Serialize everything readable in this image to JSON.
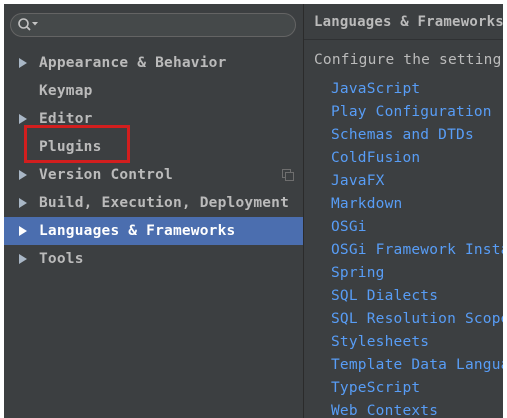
{
  "search": {
    "placeholder": "",
    "value": ""
  },
  "tree": {
    "items": [
      {
        "label": "Appearance & Behavior",
        "expandable": true
      },
      {
        "label": "Keymap",
        "expandable": false
      },
      {
        "label": "Editor",
        "expandable": true
      },
      {
        "label": "Plugins",
        "expandable": false,
        "highlighted": true
      },
      {
        "label": "Version Control",
        "expandable": true
      },
      {
        "label": "Build, Execution, Deployment",
        "expandable": true
      },
      {
        "label": "Languages & Frameworks",
        "expandable": true,
        "selected": true
      },
      {
        "label": "Tools",
        "expandable": true
      }
    ]
  },
  "panel": {
    "title": "Languages & Frameworks",
    "description": "Configure the settings",
    "links": [
      "JavaScript",
      "Play Configuration",
      "Schemas and DTDs",
      "ColdFusion",
      "JavaFX",
      "Markdown",
      "OSGi",
      "OSGi Framework Instances",
      "Spring",
      "SQL Dialects",
      "SQL Resolution Scopes",
      "Stylesheets",
      "Template Data Languages",
      "TypeScript",
      "Web Contexts"
    ]
  },
  "colors": {
    "background": "#3c3f41",
    "selection": "#4b6eaf",
    "link": "#589df6",
    "text": "#bbbbbb",
    "highlight_border": "#d21e1e"
  },
  "icons": {
    "search": "search-icon",
    "expand": "triangle-right-icon",
    "project_scope": "copy-icon"
  }
}
